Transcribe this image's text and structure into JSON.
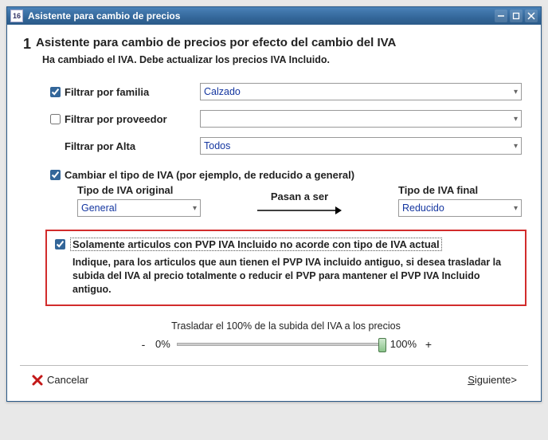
{
  "window": {
    "title": "Asistente para cambio de precios"
  },
  "step": {
    "number": "1",
    "title": "Asistente para cambio de precios por efecto del cambio del IVA",
    "subtitle": "Ha cambiado el IVA. Debe actualizar los precios IVA Incluido."
  },
  "filters": {
    "family_label": "Filtrar por familia",
    "family_value": "Calzado",
    "supplier_label": "Filtrar por proveedor",
    "supplier_value": "",
    "alta_label": "Filtrar por Alta",
    "alta_value": "Todos"
  },
  "change_iva": {
    "label": "Cambiar el tipo de IVA (por ejemplo, de reducido a general)",
    "orig_header": "Tipo de IVA original",
    "orig_value": "General",
    "pasan": "Pasan a ser",
    "final_header": "Tipo de IVA final",
    "final_value": "Reducido"
  },
  "highlight": {
    "label": "Solamente articulos con PVP IVA Incluido no acorde con tipo de IVA actual",
    "text": "Indique, para los articulos que aun tienen el PVP IVA incluido antiguo, si desea trasladar la subida del IVA al precio totalmente o reducir el PVP para mantener el PVP IVA Incluido antiguo."
  },
  "slider": {
    "caption": "Trasladar el 100% de la subida del IVA a los precios",
    "min_label": "0%",
    "max_label": "100%",
    "minus": "-",
    "plus": "+"
  },
  "footer": {
    "cancel": "Cancelar",
    "next": "Siguiente>",
    "next_ul": "S",
    "next_rest": "iguiente>"
  }
}
